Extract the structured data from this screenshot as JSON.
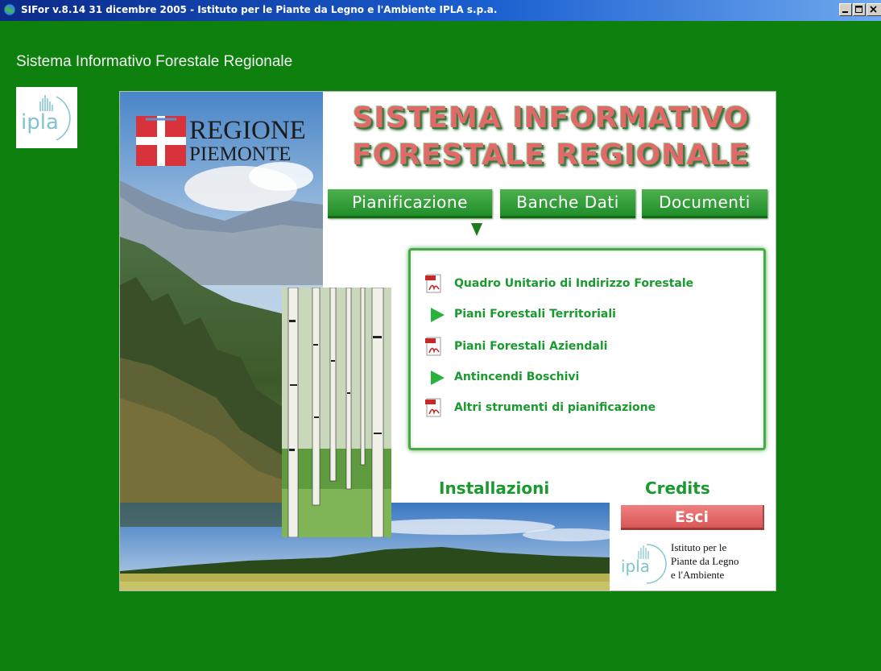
{
  "window": {
    "title": "SIFor  v.8.14 31 dicembre 2005 -  Istituto per le Piante da Legno e l'Ambiente  IPLA s.p.a."
  },
  "app": {
    "heading": "Sistema Informativo Forestale Regionale"
  },
  "branding": {
    "regione_line1": "REGIONE",
    "regione_line2": "PIEMONTE",
    "title_line1": "SISTEMA INFORMATIVO",
    "title_line2": "FORESTALE REGIONALE",
    "ipla_logo_text": "ipla"
  },
  "tabs": [
    {
      "label": "Pianificazione",
      "selected": true
    },
    {
      "label": "Banche Dati",
      "selected": false
    },
    {
      "label": "Documenti",
      "selected": false
    }
  ],
  "menu": {
    "items": [
      {
        "label": "Quadro Unitario di Indirizzo Forestale",
        "icon": "pdf-icon"
      },
      {
        "label": "Piani Forestali Territoriali",
        "icon": "play-arrow-icon"
      },
      {
        "label": "Piani Forestali Aziendali",
        "icon": "pdf-icon"
      },
      {
        "label": "Antincendi Boschivi",
        "icon": "play-arrow-icon"
      },
      {
        "label": "Altri strumenti di pianificazione",
        "icon": "pdf-icon"
      }
    ]
  },
  "links": {
    "install": "Installazioni",
    "credits": "Credits",
    "exit": "Esci"
  },
  "footer": {
    "ipla_line1": "Istituto per le",
    "ipla_line2": "Piante da Legno",
    "ipla_line3": "e l'Ambiente"
  },
  "colors": {
    "background": "#0e800e",
    "accent_green": "#1a9a2e",
    "title_red": "#e06a6a",
    "exit_red": "#e06a6a"
  }
}
